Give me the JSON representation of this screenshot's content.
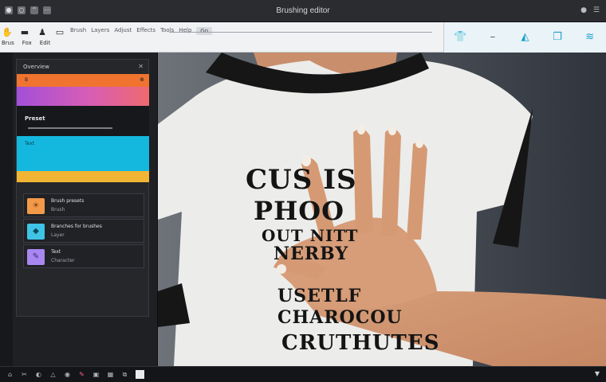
{
  "window": {
    "title": "Brushing editor",
    "controls": [
      "●",
      "○",
      "⌃",
      "⋯"
    ]
  },
  "toolbar": {
    "left_icons": [
      "hand-icon",
      "brush-icon",
      "stamp-icon",
      "text-icon"
    ],
    "sub_labels": [
      "Brus",
      "Fox",
      "Edit"
    ],
    "menu_items": [
      "Brush",
      "Layers",
      "Adjust",
      "Effects",
      "Tools",
      "Help"
    ],
    "search_chip": "Go",
    "right_icons": [
      "shirt-icon",
      "minus-icon",
      "fish-icon",
      "layers-icon",
      "gauge-icon"
    ]
  },
  "sidebar": {
    "panel_title": "Overview",
    "swatches": [
      {
        "label": "B",
        "color": "#f0742f"
      },
      {
        "label": "",
        "color": "#d85db5"
      },
      {
        "label": "Preset",
        "color": "#17181b"
      },
      {
        "label": "Text",
        "color": "#14b8df"
      },
      {
        "label": "",
        "color": "#f2b533"
      }
    ],
    "items": [
      {
        "title": "Brush presets",
        "subtitle": "Brush",
        "thumb_color": "#f39a4a",
        "icon": "☀"
      },
      {
        "title": "Branches for brushes",
        "subtitle": "Layer",
        "thumb_color": "#3fc4e6",
        "icon": "◆"
      },
      {
        "title": "Text",
        "subtitle": "Character",
        "thumb_color": "#a987f0",
        "icon": "✎"
      }
    ]
  },
  "canvas": {
    "shirt_lines": [
      "CUS IS",
      "PHOO",
      "OUT NITT",
      "NERBY",
      "USETLF",
      "CHAROCOU",
      "CRUTHUTES"
    ]
  },
  "statusbar": {
    "tools": [
      "⌂",
      "✂",
      "◐",
      "△",
      "◉",
      "✎",
      "▣",
      "▦",
      "⧉",
      ""
    ],
    "right": "▼"
  }
}
